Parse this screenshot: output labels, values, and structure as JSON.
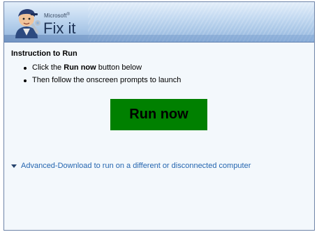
{
  "header": {
    "brand_small": "Microsoft",
    "brand_name": "Fix it",
    "brand_registered": "®"
  },
  "instructions": {
    "heading": "Instruction to Run",
    "step1_prefix": "Click the ",
    "step1_bold": "Run now",
    "step1_suffix": " button below",
    "step2": "Then follow the onscreen prompts to launch"
  },
  "run_button_label": "Run now",
  "advanced_link_label": "Advanced-Download to run on a different or disconnected computer",
  "colors": {
    "run_button": "#008000",
    "link": "#2566b0"
  },
  "icons": {
    "mascot": "fixit-mechanic-icon",
    "expander": "expand-triangle-icon"
  }
}
